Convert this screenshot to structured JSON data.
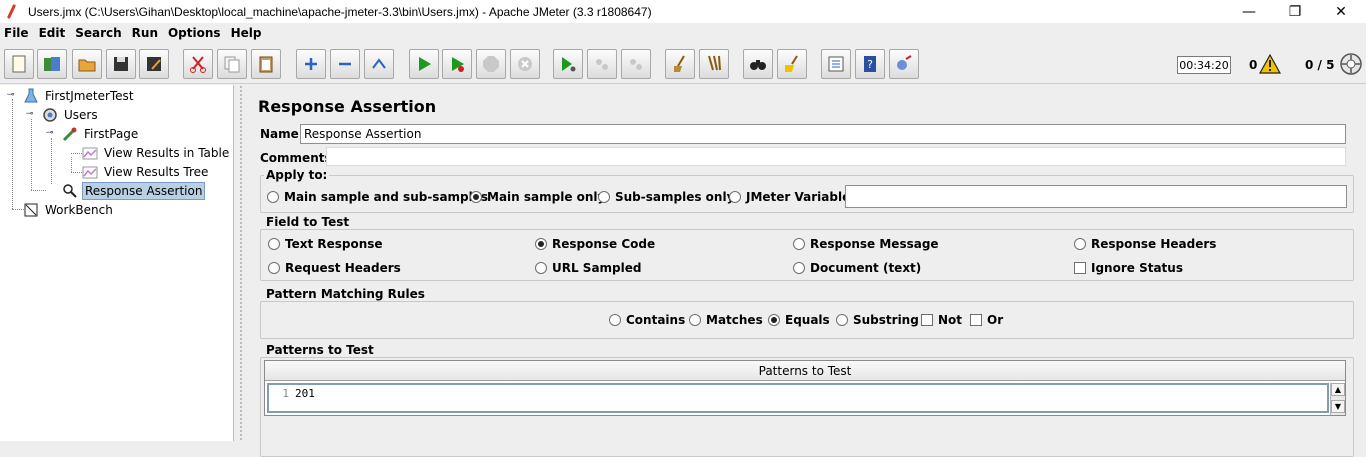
{
  "window": {
    "title": "Users.jmx (C:\\Users\\Gihan\\Desktop\\local_machine\\apache-jmeter-3.3\\bin\\Users.jmx) - Apache JMeter (3.3 r1808647)",
    "minimize": "—",
    "restore": "❐",
    "close": "✕"
  },
  "menu": [
    "File",
    "Edit",
    "Search",
    "Run",
    "Options",
    "Help"
  ],
  "status": {
    "timer": "00:34:20",
    "error_count": "0",
    "threads": "0 / 5"
  },
  "tree": {
    "items": [
      {
        "label": "FirstJmeterTest",
        "icon": "test-plan-icon"
      },
      {
        "label": "Users",
        "icon": "thread-group-icon"
      },
      {
        "label": "FirstPage",
        "icon": "sampler-icon"
      },
      {
        "label": "View Results in Table",
        "icon": "listener-icon"
      },
      {
        "label": "View Results Tree",
        "icon": "listener-icon"
      },
      {
        "label": "Response Assertion",
        "icon": "assertion-icon"
      },
      {
        "label": "WorkBench",
        "icon": "workbench-icon"
      }
    ]
  },
  "panel": {
    "title": "Response Assertion",
    "name_label": "Name:",
    "name_value": "Response Assertion",
    "comments_label": "Comments:",
    "comments_value": "",
    "apply_to": {
      "title": "Apply to:",
      "options": [
        "Main sample and sub-samples",
        "Main sample only",
        "Sub-samples only",
        "JMeter Variable"
      ],
      "selected": "Main sample only",
      "variable_value": ""
    },
    "field_to_test": {
      "title": "Field to Test",
      "options": [
        "Text Response",
        "Response Code",
        "Response Message",
        "Response Headers",
        "Request Headers",
        "URL Sampled",
        "Document (text)"
      ],
      "checkbox": "Ignore Status",
      "selected": "Response Code"
    },
    "pattern_rules": {
      "title": "Pattern Matching Rules",
      "options": [
        "Contains",
        "Matches",
        "Equals",
        "Substring"
      ],
      "checkboxes": [
        "Not",
        "Or"
      ],
      "selected": "Equals"
    },
    "patterns": {
      "title": "Patterns to Test",
      "column": "Patterns to Test",
      "rows": [
        {
          "line": "1",
          "value": "201"
        }
      ]
    }
  }
}
